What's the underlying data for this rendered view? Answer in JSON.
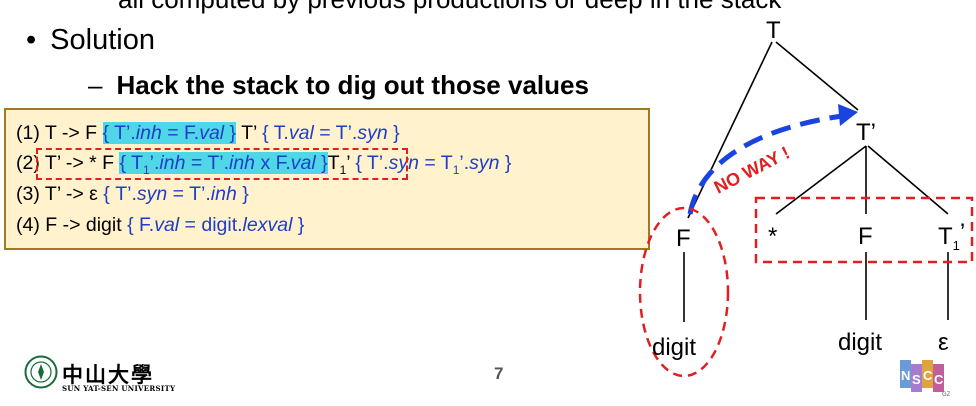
{
  "slide": {
    "top_cut_text": "all computed by previous productions or deep in the stack",
    "bullet": "Solution",
    "sub_bullet": "Hack the stack to dig out those values",
    "page_number": "7"
  },
  "rules": [
    {
      "num": "(1) ",
      "head": "T -> F ",
      "a1": "{ T’.",
      "a1i": "inh",
      "a1b": " = F.",
      "a1c": "val",
      "a1d": " }",
      "mid": " T’ ",
      "a2": "{ T.",
      "a2i": "val",
      "a2b": " = T’.",
      "a2c": "syn",
      "a2d": " }"
    },
    {
      "num": "(2) ",
      "head": "T’ -> * F ",
      "a1": "{ T",
      "a1sub": "1",
      "a1b": "’.",
      "a1i": "inh",
      "a1c": " = T’.",
      "a1ci": "inh",
      "a1d": " x F.",
      "a1di": "val",
      "a1e": " }",
      "mid": "T",
      "midsub": "1",
      "mid2": "’  ",
      "a2": "{ T’.",
      "a2i": "syn",
      "a2b": " = T",
      "a2sub": "1",
      "a2c": "’.",
      "a2ci": "syn",
      "a2d": " }"
    },
    {
      "num": "(3) ",
      "head": "T’ -> ε ",
      "a1": "{ T’.",
      "a1i": "syn",
      "a1b": " = T’.",
      "a1c": "inh",
      "a1d": " }"
    },
    {
      "num": "(4) ",
      "head": "F -> digit ",
      "a1": "{ F.",
      "a1i": "val",
      "a1b": " = digit.",
      "a1c": "lexval",
      "a1d": " }"
    }
  ],
  "tree": {
    "root": "T",
    "t_prime": "T’",
    "f": "F",
    "star": "*",
    "f2": "F",
    "t1": "T",
    "t1_sub": "1",
    "t1_prime": "’",
    "digit_left": "digit",
    "digit_right": "digit",
    "epsilon": "ε",
    "annotation": "NO WAY !"
  },
  "footer": {
    "university_cn": "中山大學",
    "university_en": "SUN YAT-SEN UNIVERSITY",
    "nscc_letters": [
      "N",
      "S",
      "C",
      "C"
    ],
    "nscc_small": "GZ"
  },
  "colors": {
    "box_fill": "#fff2cc",
    "box_border": "#a07a1c",
    "semantic_text": "#1f3ec8",
    "highlight": "#4fd7e8",
    "dash_red": "#e02020",
    "arrow_blue": "#1a44e0",
    "univ_green": "#1a6b3c"
  }
}
